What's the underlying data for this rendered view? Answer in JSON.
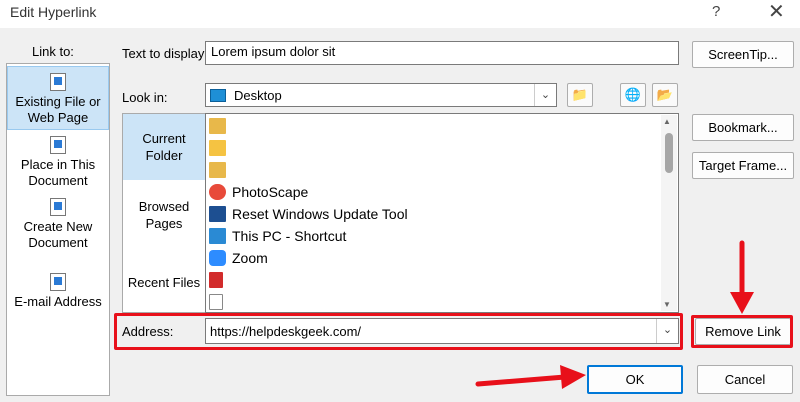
{
  "window": {
    "title": "Edit Hyperlink",
    "help_glyph": "?",
    "close_glyph": "✕"
  },
  "link_to": {
    "label": "Link to:",
    "items": [
      {
        "line1": "Existing File or",
        "line2": "Web Page",
        "accel": "x",
        "icon": "existing-file-icon"
      },
      {
        "line1": "Place in This",
        "line2": "Document",
        "accel": "a",
        "icon": "place-in-document-icon"
      },
      {
        "line1": "Create New",
        "line2": "Document",
        "accel": "N",
        "icon": "create-new-document-icon"
      },
      {
        "line1": "E-mail Address",
        "line2": "",
        "accel": "m",
        "icon": "email-address-icon"
      }
    ]
  },
  "text_to_display": {
    "label": "Text to display:",
    "value": "Lorem ipsum dolor sit"
  },
  "look_in": {
    "label": "Look in:",
    "value": "Desktop"
  },
  "nav": [
    {
      "line1": "Current",
      "line2": "Folder"
    },
    {
      "line1": "Browsed",
      "line2": "Pages"
    },
    {
      "line1": "Recent Files",
      "line2": ""
    }
  ],
  "files": [
    {
      "name": "",
      "icon": "folder-shortcut-icon",
      "color": "#e8b84a"
    },
    {
      "name": "",
      "icon": "folder-icon",
      "color": "#f5c342"
    },
    {
      "name": "",
      "icon": "folder-shortcut-icon",
      "color": "#e8b84a"
    },
    {
      "name": "PhotoScape",
      "icon": "photoscape-icon",
      "color": "#e84a3a"
    },
    {
      "name": "Reset Windows Update Tool",
      "icon": "reset-tool-icon",
      "color": "#1d4f91"
    },
    {
      "name": "This PC - Shortcut",
      "icon": "this-pc-icon",
      "color": "#2a8ad4"
    },
    {
      "name": "Zoom",
      "icon": "zoom-icon",
      "color": "#2d8cff"
    },
    {
      "name": "",
      "icon": "pdf-icon",
      "color": "#d22b2b"
    },
    {
      "name": "",
      "icon": "document-icon",
      "color": "#3b6fb6"
    }
  ],
  "address": {
    "label": "Address:",
    "value": "https://helpdeskgeek.com/"
  },
  "buttons": {
    "screentip": "ScreenTip...",
    "bookmark": "Bookmark...",
    "target_frame": "Target Frame...",
    "remove_link": "Remove Link",
    "ok": "OK",
    "cancel": "Cancel"
  },
  "colors": {
    "accent": "#0078d7",
    "highlight": "#e8101a",
    "selection": "#cce4f7"
  }
}
